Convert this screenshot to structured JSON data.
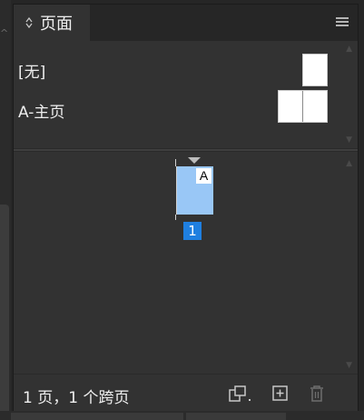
{
  "panel": {
    "tab_label": "页面",
    "tab_arrows_icon": "up-down-arrows-icon",
    "menu_icon": "hamburger-menu-icon"
  },
  "masters": {
    "items": [
      {
        "label": "[无]",
        "spread": "single"
      },
      {
        "label": "A-主页",
        "spread": "facing"
      }
    ]
  },
  "pages": {
    "items": [
      {
        "number": "1",
        "master_prefix": "A",
        "selected": true
      }
    ]
  },
  "footer": {
    "status": "1 页，1 个跨页",
    "buttons": [
      {
        "name": "edit-page-size-button",
        "icon": "page-size-icon"
      },
      {
        "name": "new-page-button",
        "icon": "new-page-icon"
      },
      {
        "name": "delete-page-button",
        "icon": "trash-icon",
        "enabled": false
      }
    ]
  },
  "colors": {
    "panel_bg": "#323232",
    "tabbar_bg": "#262626",
    "page_thumb": "#99c7f6",
    "selection": "#1f7fe0"
  }
}
